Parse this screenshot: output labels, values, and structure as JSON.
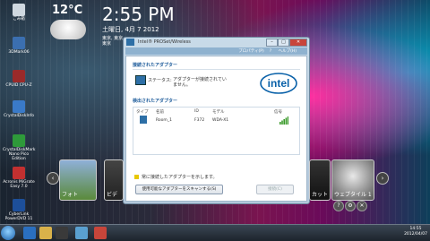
{
  "desktop": {
    "icons": [
      {
        "label": "ごみ箱"
      },
      {
        "label": "3DMark06"
      },
      {
        "label": "CPUID CPU-Z"
      },
      {
        "label": "CrystalDiskInfo"
      },
      {
        "label": "CrystalDiskMark Nano Pico Edition"
      },
      {
        "label": "Acronis MiGrate Easy 7.0"
      },
      {
        "label": "CyberLink PowerDVD 11"
      }
    ]
  },
  "gadgets": {
    "weather_temp": "12°C",
    "time": "2:55 PM",
    "date": "土曜日, 4月 7 2012",
    "city": "東京, 東京",
    "city2": "東京"
  },
  "window": {
    "title": "Intel® PROSet/Wireless",
    "menu": [
      "プロパティ(P)",
      "ヘルプ(H)"
    ],
    "connected_heading": "接続されたアダプター",
    "status_label": "ステータス:",
    "status_value": "アダプターが接続されていません。",
    "brand": "intel",
    "detected_heading": "検出されたアダプター",
    "table_headers": [
      "タイプ",
      "名前",
      "ID",
      "モデル",
      "信号"
    ],
    "table_rows": [
      {
        "name": "Room_1",
        "id": "F372",
        "model": "WDA-X1"
      }
    ],
    "info_text": "常に接続したアダプターを示します。",
    "scan_button": "使用可能なアダプターをスキャンする(S)",
    "connect_button": "接続(C)"
  },
  "media_strip": {
    "thumbs": [
      {
        "label": "フォト"
      },
      {
        "label": "ビデ"
      },
      {
        "label": "カット"
      },
      {
        "label": "ウェブタイル 1"
      }
    ]
  },
  "taskbar": {
    "time": "14:55",
    "date": "2012/04/07"
  },
  "colors": {
    "accent": "#1b5a9a",
    "close": "#c8453a",
    "signal": "#3a9a2a"
  }
}
